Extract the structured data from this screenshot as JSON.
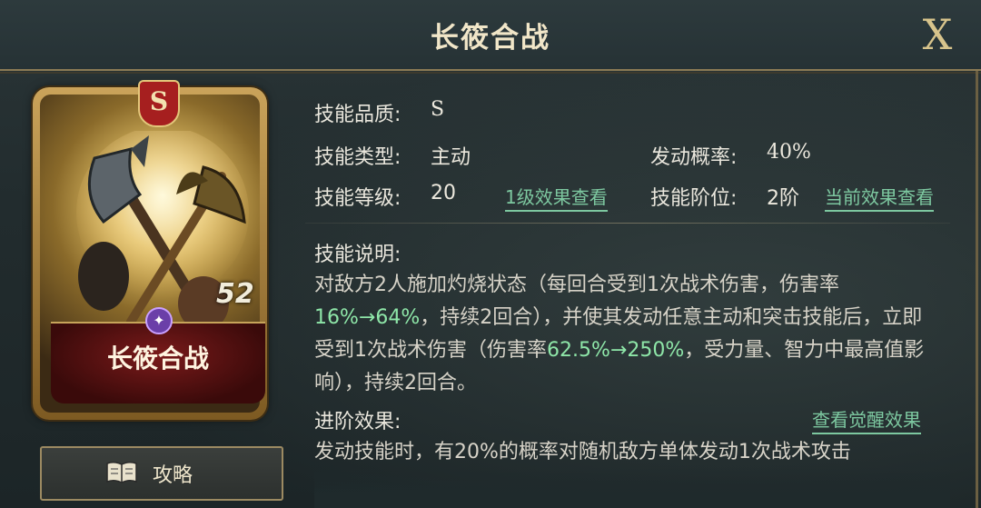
{
  "header": {
    "title": "长筱合战",
    "close_label": "X"
  },
  "card": {
    "name": "长筱合战",
    "grade_badge": "S",
    "level_mark": "52"
  },
  "guide_button": {
    "label": "攻略",
    "icon": "book-icon"
  },
  "info": {
    "quality_label": "技能品质:",
    "quality_value": "S",
    "type_label": "技能类型:",
    "type_value": "主动",
    "prob_label": "发动概率:",
    "prob_value": "40%",
    "level_label": "技能等级:",
    "level_value": "20",
    "level_link": "1级效果查看",
    "rank_label": "技能阶位:",
    "rank_value": "2阶",
    "rank_link": "当前效果查看"
  },
  "description": {
    "label": "技能说明:",
    "part1": "对敌方2人施加灼烧状态（每回合受到1次战术伤害，伤害率",
    "hl1": "16%→64%",
    "part2": "，持续2回合），并使其发动任意主动和突击技能后，立即受到1次战术伤害（伤害率",
    "hl2": "62.5%→250%",
    "part3": "，受力量、智力中最高值影响），持续2回合。"
  },
  "advance": {
    "label": "进阶效果:",
    "link": "查看觉醒效果",
    "text": "发动技能时，有20%的概率对随机敌方单体发动1次战术攻击"
  },
  "colors": {
    "accent_green": "#8ee6a8",
    "link_green": "#7dc8a0",
    "gold": "#d8c48c"
  }
}
